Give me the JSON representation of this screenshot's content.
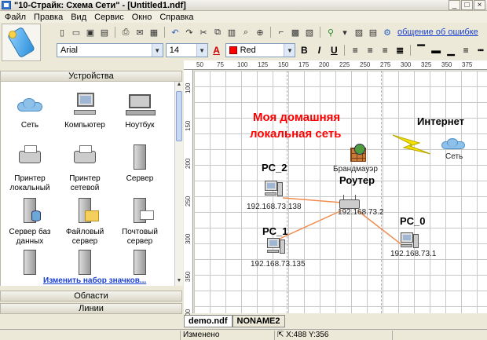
{
  "window": {
    "title": "\"10-Страйк: Схема Сети\" - [Untitled1.ndf]",
    "buttons": [
      "_",
      "□",
      "×"
    ]
  },
  "menu": [
    "Файл",
    "Правка",
    "Вид",
    "Сервис",
    "Окно",
    "Справка"
  ],
  "toolbar": {
    "error_link": "общение об ошибке"
  },
  "format_bar": {
    "font_name": "Arial",
    "font_size": "14",
    "color_name": "Red",
    "color_hex": "#ff0000",
    "bold": "B",
    "italic": "I",
    "underline": "U"
  },
  "left_panel": {
    "header_devices": "Устройства",
    "devices": [
      {
        "label": "Сеть",
        "icon": "cloud-icon"
      },
      {
        "label": "Компьютер",
        "icon": "computer-icon"
      },
      {
        "label": "Ноутбук",
        "icon": "laptop-icon"
      },
      {
        "label": "Принтер локальный",
        "icon": "printer-icon"
      },
      {
        "label": "Принтер сетевой",
        "icon": "network-printer-icon"
      },
      {
        "label": "Сервер",
        "icon": "server-icon"
      },
      {
        "label": "Сервер баз данных",
        "icon": "database-server-icon"
      },
      {
        "label": "Файловый сервер",
        "icon": "file-server-icon"
      },
      {
        "label": "Почтовый сервер",
        "icon": "mail-server-icon"
      }
    ],
    "change_icons_link": "Изменить набор значков...",
    "header_areas": "Области",
    "header_lines": "Линии"
  },
  "ruler": {
    "top": [
      "50",
      "75",
      "100",
      "125",
      "150",
      "175",
      "200",
      "225",
      "250",
      "275",
      "300",
      "325",
      "350",
      "375"
    ],
    "left": [
      "100",
      "150",
      "200",
      "250",
      "300",
      "350",
      "400"
    ]
  },
  "diagram": {
    "title_line1": "Моя домашняя",
    "title_line2": "локальная сеть",
    "internet_label": "Интернет",
    "cloud_label": "Сеть",
    "firewall_label": "Брандмауэр",
    "router_label": "Роутер",
    "router_ip": "192.168.73.2",
    "pc2_label": "PC_2",
    "pc2_ip": "192.168.73.138",
    "pc1_label": "PC_1",
    "pc1_ip": "192.168.73.135",
    "pc0_label": "PC_0",
    "pc0_ip": "192.168.73.1",
    "link_color": "#f08c50",
    "lightning_color": "#f5e200"
  },
  "tabs": [
    "demo.ndf",
    "NONAME2"
  ],
  "status": {
    "state": "Изменено",
    "coords": "X:488  Y:356"
  }
}
